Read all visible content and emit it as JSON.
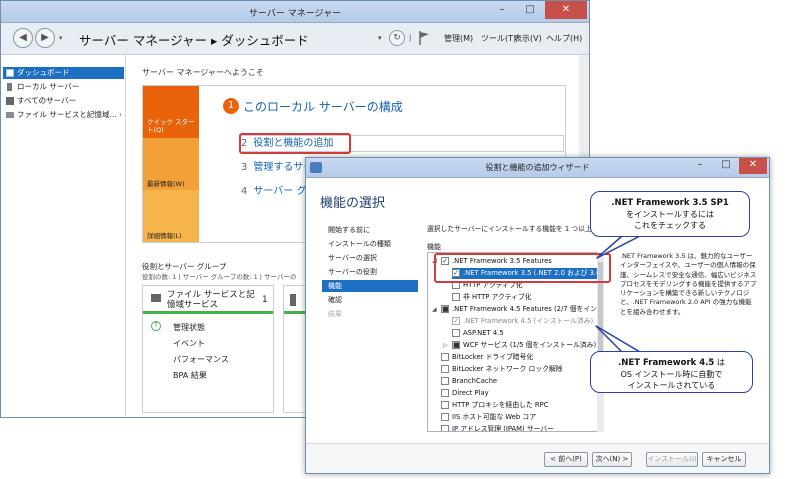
{
  "server_manager": {
    "title": "サーバー マネージャー",
    "breadcrumb": "サーバー マネージャー ▸ ダッシュボード",
    "menu": [
      "管理(M)",
      "ツール(T)",
      "表示(V)",
      "ヘルプ(H)"
    ],
    "sidebar": [
      {
        "label": "ダッシュボード",
        "icon": "dashboard-icon"
      },
      {
        "label": "ローカル サーバー",
        "icon": "server-icon"
      },
      {
        "label": "すべてのサーバー",
        "icon": "servers-icon"
      },
      {
        "label": "ファイル サービスと記憶域…",
        "icon": "file-services-icon",
        "chevron": "›"
      }
    ],
    "welcome": "サーバー マネージャーへようこそ",
    "quickstart": {
      "tiles": [
        "クイック スタート(Q)",
        "最新情報(W)",
        "詳細情報(L)"
      ],
      "step1_number": "1",
      "title": "このローカル サーバーの構成",
      "steps": [
        {
          "n": "2",
          "label": "役割と機能の追加"
        },
        {
          "n": "3",
          "label": "管理するサーバーの追加"
        },
        {
          "n": "4",
          "label": "サーバー グループの作成"
        }
      ]
    },
    "roles": {
      "title": "役割とサーバー グループ",
      "count": "役割の数: 1 | サーバー グループの数: 1 | サーバーの",
      "tile": {
        "title": "ファイル サービスと記憶域サービス",
        "count": "1",
        "items": [
          "管理状態",
          "イベント",
          "パフォーマンス",
          "BPA 結果"
        ]
      }
    }
  },
  "wizard": {
    "title": "役割と機能の追加ウィザード",
    "heading": "機能の選択",
    "nav": [
      "開始する前に",
      "インストールの種類",
      "サーバーの選択",
      "サーバーの役割",
      "機能",
      "確認",
      "結果"
    ],
    "active_index": 4,
    "description": "選択したサーバーにインストールする機能を 1 つ以上選択します。",
    "features_label": "機能",
    "features": [
      {
        "label": ".NET Framework 3.5 Features",
        "checked": true,
        "level": 0,
        "expander": "◢"
      },
      {
        "label": ".NET Framework 3.5 (.NET 2.0 および 3.0 を含む)",
        "checked": true,
        "level": 1,
        "selected": true
      },
      {
        "label": "HTTP アクティブ化",
        "checked": false,
        "level": 1
      },
      {
        "label": "非 HTTP アクティブ化",
        "checked": false,
        "level": 1
      },
      {
        "label": ".NET Framework 4.5 Features (2/7 個をインストール済み)",
        "checked": "partial",
        "level": 0,
        "expander": "◢"
      },
      {
        "label": ".NET Framework 4.5 (インストール済み)",
        "checked": true,
        "level": 1,
        "disabled": true
      },
      {
        "label": "ASP.NET 4.5",
        "checked": false,
        "level": 1
      },
      {
        "label": "WCF サービス (1/5 個をインストール済み)",
        "checked": "partial",
        "level": 1,
        "expander": "▷"
      },
      {
        "label": "BitLocker ドライブ暗号化",
        "checked": false,
        "level": 0
      },
      {
        "label": "BitLocker ネットワーク ロック解除",
        "checked": false,
        "level": 0
      },
      {
        "label": "BranchCache",
        "checked": false,
        "level": 0
      },
      {
        "label": "Direct Play",
        "checked": false,
        "level": 0
      },
      {
        "label": "HTTP プロキシを経由した RPC",
        "checked": false,
        "level": 0
      },
      {
        "label": "IIS ホスト可能な Web コア",
        "checked": false,
        "level": 0
      },
      {
        "label": "IP アドレス管理 (IPAM) サーバー",
        "checked": false,
        "level": 0
      }
    ],
    "details": ".NET Framework 3.5 は、魅力的なユーザー インターフェイスや、ユーザーの個人情報の保護、シームレスで安全な通信、幅広いビジネス プロセスをモデリングする機能を提供するアプリケーションを構築できる新しいテクノロジと、.NET Framework 2.0 API の強力な機能とを組み合わせます。",
    "buttons": {
      "prev": "< 前へ(P)",
      "next": "次へ(N) >",
      "install": "インストール(I)",
      "cancel": "キャンセル"
    }
  },
  "callouts": {
    "c1": {
      "title": ".NET Framework 3.5 SP1",
      "line1": "をインストールするには",
      "line2": "これをチェックする"
    },
    "c2": {
      "title": ".NET Framework 4.5",
      "title_suffix": " は",
      "line1": "OS インストール時に自動で",
      "line2": "インストールされている"
    }
  },
  "colors": {
    "accent": "#1d6fc4",
    "orange": "#e8630a",
    "callout_red": "#d63a3a",
    "bubble_border": "#2b3fa8"
  }
}
